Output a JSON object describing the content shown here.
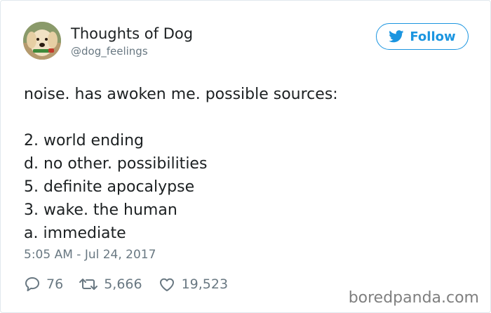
{
  "author": {
    "display_name": "Thoughts of Dog",
    "handle": "@dog_feelings",
    "avatar_icon": "dog-avatar"
  },
  "follow_button": {
    "label": "Follow",
    "icon": "twitter-bird-icon"
  },
  "tweet": {
    "lines": [
      "noise. has awoken me. possible sources:",
      "",
      "2. world ending",
      "d. no other. possibilities",
      "5. definite apocalypse",
      "3. wake. the human",
      "a. immediate"
    ],
    "timestamp": "5:05 AM - Jul 24, 2017"
  },
  "actions": {
    "replies": "76",
    "retweets": "5,666",
    "likes": "19,523"
  },
  "watermark": "boredpanda.com",
  "colors": {
    "accent": "#1b95e0",
    "text": "#1c2022",
    "muted": "#697882"
  }
}
